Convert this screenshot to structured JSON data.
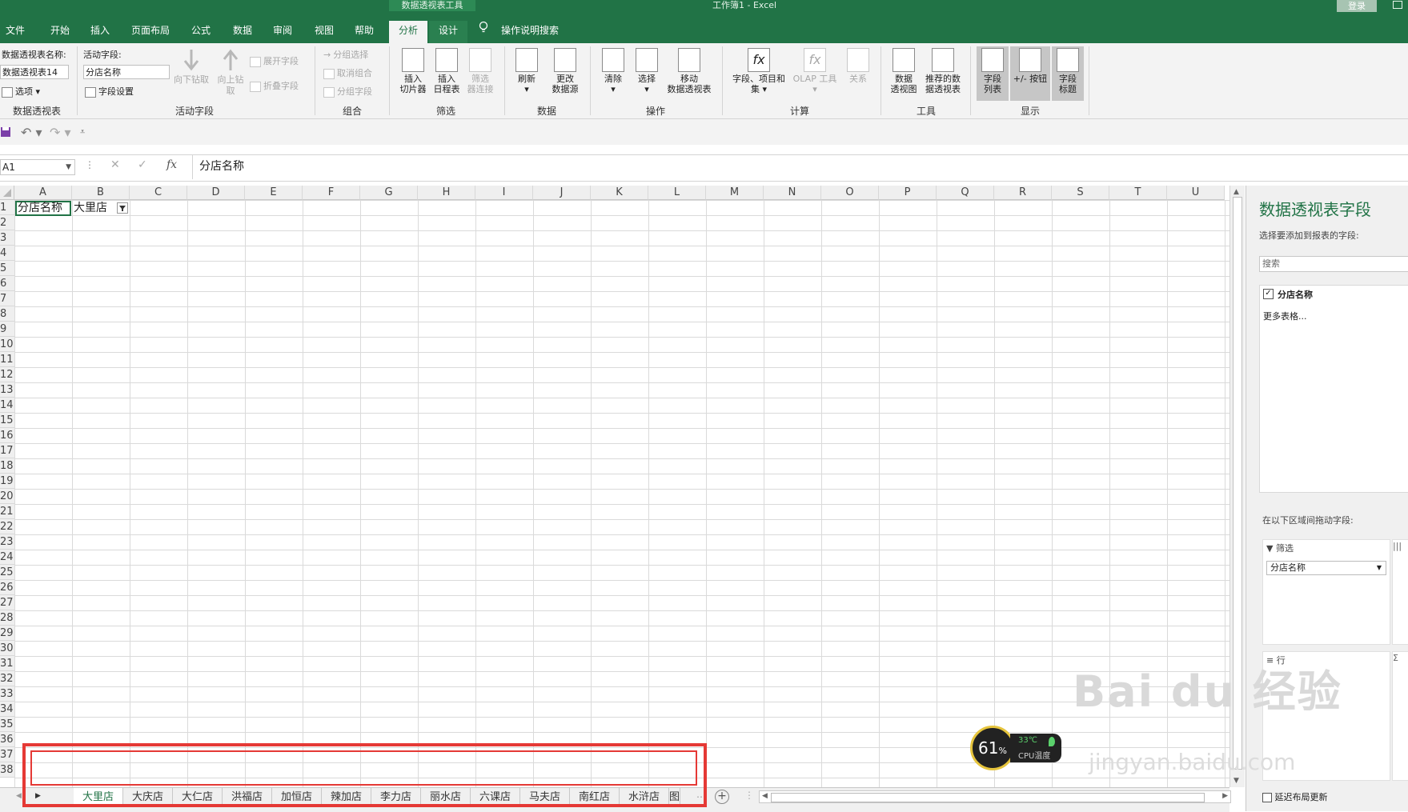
{
  "titlebar": {
    "context_tools": "数据透视表工具",
    "window_title": "工作簿1  -  Excel",
    "login": "登录",
    "tabs": [
      "文件",
      "开始",
      "插入",
      "页面布局",
      "公式",
      "数据",
      "审阅",
      "视图",
      "帮助",
      "分析",
      "设计"
    ],
    "active_tab": "分析",
    "tell_me": "操作说明搜索"
  },
  "ribbon": {
    "pivot": {
      "name_label": "数据透视表名称:",
      "name_value": "数据透视表14",
      "options": "选项",
      "group": "数据透视表"
    },
    "active_field": {
      "label": "活动字段:",
      "value": "分店名称",
      "settings": "字段设置",
      "drill_down": "向下钻取",
      "drill_up": "向上钻",
      "drill_up2": "取",
      "expand": "展开字段",
      "collapse": "折叠字段",
      "group": "活动字段"
    },
    "grouping": {
      "selection": "分组选择",
      "ungroup": "取消组合",
      "field": "分组字段",
      "group": "组合"
    },
    "filter": {
      "slicer": [
        "插入",
        "切片器"
      ],
      "timeline": [
        "插入",
        "日程表"
      ],
      "connections": [
        "筛选",
        "器连接"
      ],
      "group": "筛选"
    },
    "data": {
      "refresh": "刷新",
      "change_source": [
        "更改",
        "数据源"
      ],
      "group": "数据"
    },
    "actions": {
      "clear": "清除",
      "select": "选择",
      "move": [
        "移动",
        "数据透视表"
      ],
      "group": "操作"
    },
    "calc": {
      "fields_items": [
        "字段、项目和",
        "集"
      ],
      "olap": "OLAP 工具",
      "relations": "关系",
      "group": "计算"
    },
    "tools": {
      "pivotchart": [
        "数据",
        "透视图"
      ],
      "recommended": [
        "推荐的数",
        "据透视表"
      ],
      "group": "工具"
    },
    "show": {
      "field_list": [
        "字段",
        "列表"
      ],
      "buttons": "+/- 按钮",
      "headers": [
        "字段",
        "标题"
      ],
      "group": "显示"
    }
  },
  "formula_bar": {
    "name_box": "A1",
    "fx": "fx",
    "content": "分店名称"
  },
  "grid": {
    "columns": [
      "A",
      "B",
      "C",
      "D",
      "E",
      "F",
      "G",
      "H",
      "I",
      "J",
      "K",
      "L",
      "M",
      "N",
      "O",
      "P",
      "Q",
      "R",
      "S",
      "T",
      "U"
    ],
    "rows": [
      "1",
      "2",
      "3",
      "4",
      "5",
      "6",
      "7",
      "8",
      "9",
      "10",
      "11",
      "12",
      "13",
      "14",
      "15",
      "16",
      "17",
      "18",
      "19",
      "20",
      "21",
      "22",
      "23",
      "24",
      "25",
      "26",
      "27",
      "28",
      "29",
      "30",
      "31",
      "32",
      "33",
      "34",
      "35",
      "36",
      "37",
      "38"
    ],
    "a1": "分店名称",
    "b1": "大里店"
  },
  "sheets": {
    "tabs": [
      "大里店",
      "大庆店",
      "大仁店",
      "洪福店",
      "加恒店",
      "辣加店",
      "李力店",
      "丽水店",
      "六课店",
      "马夫店",
      "南红店",
      "水浒店",
      "图"
    ],
    "active": "大里店"
  },
  "cpu": {
    "percent": "61",
    "unit": "%",
    "temp": "33℃",
    "label": "CPU温度"
  },
  "pane": {
    "title": "数据透视表字段",
    "subtitle": "选择要添加到报表的字段:",
    "search_placeholder": "搜索",
    "field": "分店名称",
    "more_tables": "更多表格...",
    "drag_hint": "在以下区域间拖动字段:",
    "filters_label": "筛选",
    "filter_value": "分店名称",
    "rows_label": "行",
    "values_symbol": "Σ",
    "defer": "延迟布局更新"
  },
  "watermark": {
    "main": "Bai du 经验",
    "sub": "jingyan.baidu.com"
  },
  "colors": {
    "excel_green": "#217346",
    "red_box": "#e53935"
  }
}
